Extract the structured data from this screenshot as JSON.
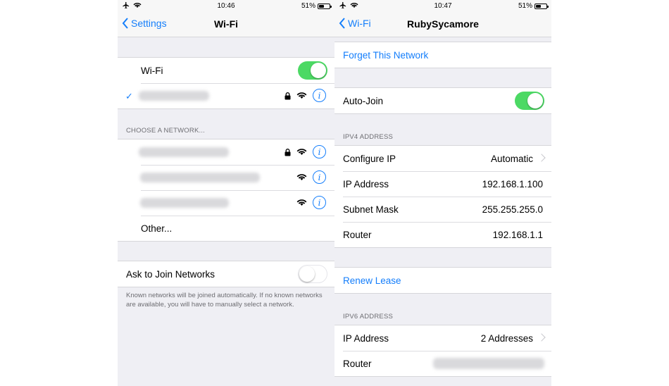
{
  "colors": {
    "accent": "#147efb",
    "toggle_on": "#4cd964",
    "group_bg": "#efeff4"
  },
  "left": {
    "status": {
      "time": "10:46",
      "battery": "51%",
      "battery_level": 0.51
    },
    "nav": {
      "back_label": "Settings",
      "title": "Wi-Fi"
    },
    "wifi_row": {
      "label": "Wi-Fi",
      "toggle": "on"
    },
    "connected_network": {
      "checkmark": "✓",
      "icons": [
        "lock-icon",
        "wifi-icon",
        "info-icon"
      ]
    },
    "choose_header": "CHOOSE A NETWORK...",
    "networks": [
      {
        "secured": true
      },
      {
        "secured": false
      },
      {
        "secured": false
      }
    ],
    "other_label": "Other...",
    "ask_to_join": {
      "label": "Ask to Join Networks",
      "toggle": "off"
    },
    "footer": "Known networks will be joined automatically. If no known networks are available, you will have to manually select a network.",
    "info_glyph": "i"
  },
  "right": {
    "status": {
      "time": "10:47",
      "battery": "51%",
      "battery_level": 0.51
    },
    "nav": {
      "back_label": "Wi-Fi",
      "title": "RubySycamore"
    },
    "forget_label": "Forget This Network",
    "auto_join": {
      "label": "Auto-Join",
      "toggle": "on"
    },
    "ipv4_header": "IPV4 ADDRESS",
    "ipv4_rows": [
      {
        "label": "Configure IP",
        "value": "Automatic"
      },
      {
        "label": "IP Address",
        "value": "192.168.1.100"
      },
      {
        "label": "Subnet Mask",
        "value": "255.255.255.0"
      },
      {
        "label": "Router",
        "value": "192.168.1.1"
      }
    ],
    "renew_label": "Renew Lease",
    "ipv6_header": "IPV6 ADDRESS",
    "ipv6_rows": [
      {
        "label": "IP Address",
        "value": "2 Addresses"
      },
      {
        "label": "Router",
        "value": ""
      }
    ]
  }
}
